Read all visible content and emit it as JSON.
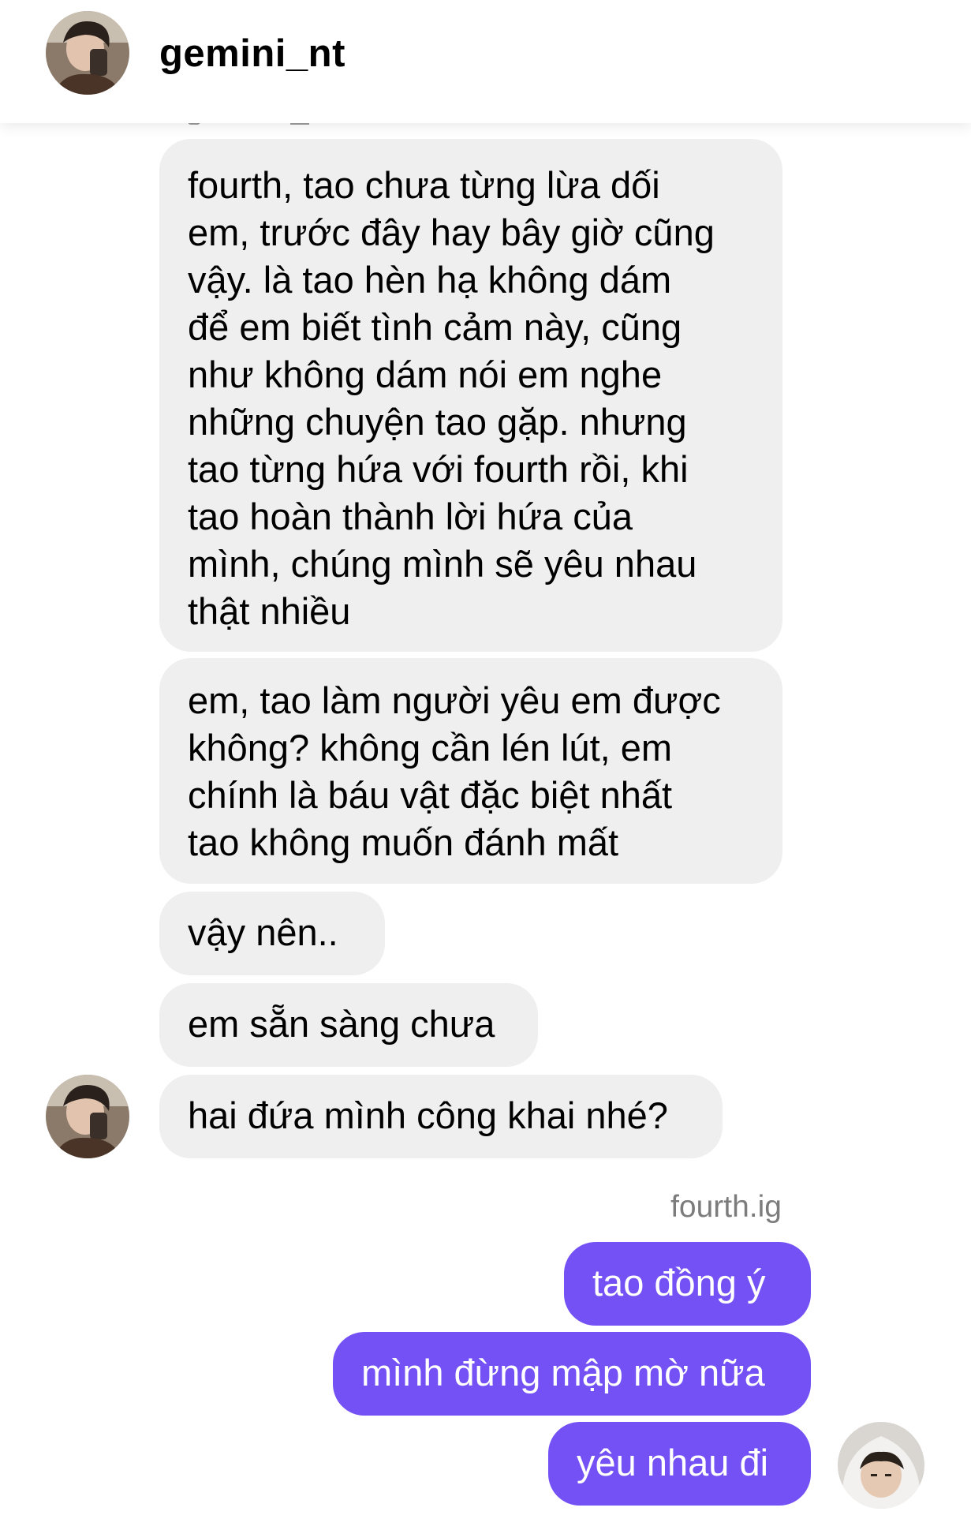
{
  "header": {
    "username": "gemini_nt"
  },
  "messages_in": [
    "fourth, tao chưa từng lừa dối\nem, trước đây hay bây giờ cũng\nvậy. là tao hèn hạ không dám\nđể em biết tình cảm này, cũng\nnhư không dám nói em nghe\nnhững chuyện tao gặp. nhưng\ntao từng hứa với fourth rồi, khi\ntao hoàn thành lời hứa của\nmình, chúng mình sẽ yêu nhau\nthật nhiều",
    "em, tao làm người yêu em được\nkhông? không cần lén lút, em\nchính là báu vật đặc biệt nhất\ntao không muốn đánh mất",
    "vậy nên..",
    "em sẵn sàng chưa",
    "hai đứa mình công khai nhé?"
  ],
  "reply": {
    "sender": "fourth.ig",
    "messages_out": [
      "tao đồng ý",
      "mình đừng mập mờ nữa",
      "yêu nhau đi"
    ]
  },
  "colors": {
    "incoming_bubble": "#efefef",
    "outgoing_bubble": "#7351f5",
    "sender_label": "#7c7c7c"
  },
  "icons": {
    "header_avatar": "profile-photo-avatar",
    "incoming_avatar": "profile-photo-avatar",
    "outgoing_avatar": "hooded-profile-avatar"
  }
}
